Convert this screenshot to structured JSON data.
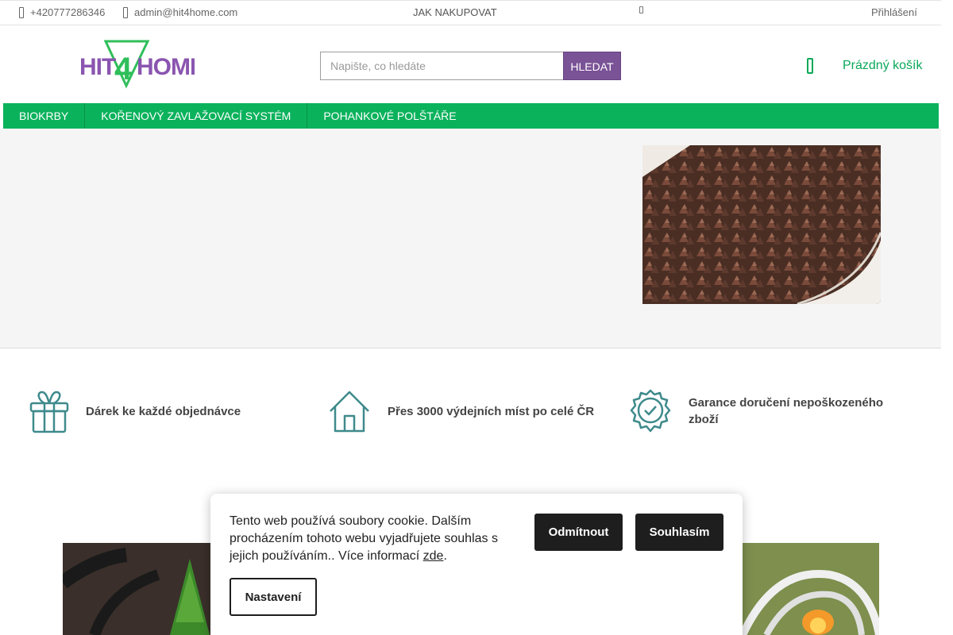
{
  "topbar": {
    "phone": "+420777286346",
    "email": "admin@hit4home.com",
    "how_to_buy": "JAK NAKUPOVAT",
    "login": "Přihlášení"
  },
  "header": {
    "logo_text": "HIT4HOME",
    "search_placeholder": "Napište, co hledáte",
    "search_button": "HLEDAT",
    "cart_label": "Prázdný košík"
  },
  "nav": {
    "items": [
      {
        "label": "BIOKRBY"
      },
      {
        "label": "KOŘENOVÝ ZAVLAŽOVACÍ SYSTÉM"
      },
      {
        "label": "POHANKOVÉ POLŠTÁŘE"
      }
    ]
  },
  "benefits": [
    {
      "label": "Dárek ke každé objednávce",
      "icon": "gift-icon"
    },
    {
      "label": "Přes 3000 výdejních míst po celé ČR",
      "icon": "house-icon"
    },
    {
      "label": "Garance doručení nepoškozeného zboží",
      "icon": "badge-check-icon"
    }
  ],
  "cookie": {
    "text": "Tento web používá soubory cookie. Dalším procházením tohoto webu vyjadřujete souhlas s jejich používáním.. Více informací ",
    "link": "zde",
    "after_link": ".",
    "reject": "Odmítnout",
    "accept": "Souhlasím",
    "settings": "Nastavení"
  },
  "colors": {
    "brand_green": "#0bb25c",
    "brand_purple": "#7a5296",
    "icon_teal": "#3f8a8c"
  }
}
